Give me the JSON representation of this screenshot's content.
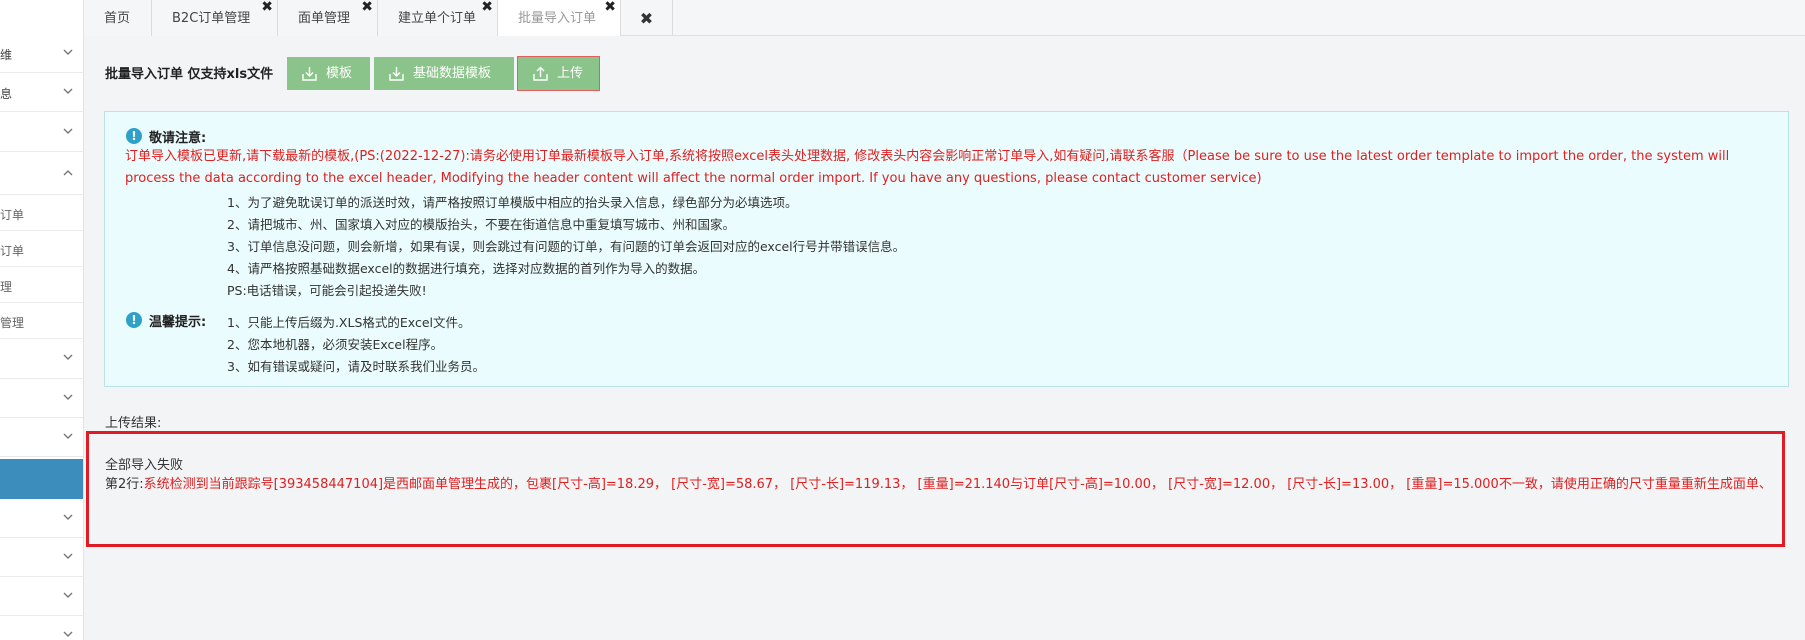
{
  "sidebar": {
    "items": [
      {
        "label": "维",
        "chevron": "down"
      },
      {
        "label": "息",
        "chevron": "down"
      },
      {
        "label": "",
        "chevron": "down"
      },
      {
        "label": "",
        "chevron": "up"
      }
    ],
    "sub_items": [
      "订单",
      "订单",
      "理",
      "管理"
    ],
    "items_after": [
      {
        "chevron": "down"
      },
      {
        "chevron": "down"
      },
      {
        "chevron": "down"
      }
    ],
    "items_bottom": [
      {
        "chevron": "down"
      },
      {
        "chevron": "down"
      },
      {
        "chevron": "down"
      },
      {
        "chevron": "down"
      }
    ]
  },
  "tabs": [
    {
      "label": "首页"
    },
    {
      "label": "B2C订单管理",
      "close": "✖"
    },
    {
      "label": "面单管理",
      "close": "✖"
    },
    {
      "label": "建立单个订单",
      "close": "✖"
    },
    {
      "label": "批量导入订单",
      "close": "✖"
    }
  ],
  "tab_close_all": "✖",
  "toolbar": {
    "title": "批量导入订单 仅支持xls文件",
    "buttons": [
      {
        "label": "模板",
        "icon": "download-icon"
      },
      {
        "label": "基础数据模板",
        "icon": "download-icon"
      },
      {
        "label": "上传",
        "icon": "upload-icon"
      }
    ]
  },
  "notice": {
    "icon_glyph": "!",
    "attention_title": "敬请注意:",
    "attention_red": "订单导入模板已更新,请下载最新的模板,(PS:(2022-12-27):请务必使用订单最新模板导入订单,系统将按照excel表头处理数据, 修改表头内容会影响正常订单导入,如有疑问,请联系客服（Please be sure to use the latest order template to import the order, the system will process the data according to the excel header, Modifying the header content will affect the normal order import. If you have any questions, please contact customer service)",
    "attention_lines": [
      "1、为了避免耽误订单的派送时效，请严格按照订单模版中相应的抬头录入信息，绿色部分为必填选项。",
      "2、请把城市、州、国家填入对应的模版抬头，不要在街道信息中重复填写城市、州和国家。",
      "3、订单信息没问题，则会新增，如果有误，则会跳过有问题的订单，有问题的订单会返回对应的excel行号并带错误信息。",
      "4、请严格按照基础数据excel的数据进行填充，选择对应数据的首列作为导入的数据。",
      "PS:电话错误，可能会引起投递失败!"
    ],
    "tips_title": "温馨提示:",
    "tips_lines": [
      "1、只能上传后缀为.XLS格式的Excel文件。",
      "2、您本地机器，必须安装Excel程序。",
      "3、如有错误或疑问，请及时联系我们业务员。"
    ]
  },
  "result": {
    "label": "上传结果:",
    "status": "全部导入失败",
    "row_no": "第2行:",
    "message": "系统检测到当前跟踪号[393458447104]是西邮面单管理生成的，包裹[尺寸-高]=18.29，  [尺寸-宽]=58.67，  [尺寸-长]=119.13，  [重量]=21.140与订单[尺寸-高]=10.00，  [尺寸-宽]=12.00，  [尺寸-长]=13.00，  [重量]=15.000不一致，请使用正确的尺寸重量重新生成面单、"
  },
  "colors": {
    "button_green": "#8bc48a",
    "error_red": "#e02020",
    "highlight_border": "#e01b24",
    "notice_bg": "#eafcfd",
    "sidebar_active": "#3c8dbc"
  }
}
